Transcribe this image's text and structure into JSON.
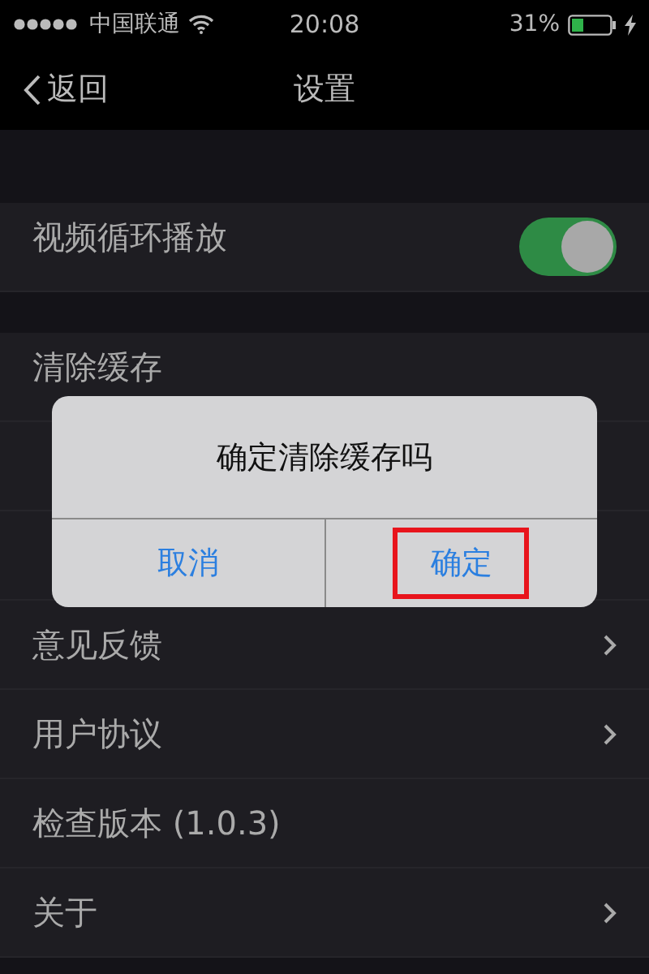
{
  "status_bar": {
    "carrier": "中国联通",
    "time": "20:08",
    "battery": "31%"
  },
  "nav": {
    "back": "返回",
    "title": "设置"
  },
  "sections": [
    {
      "rows": [
        {
          "kind": "toggle",
          "label": "视频循环播放",
          "on": true
        }
      ]
    },
    {
      "rows": [
        {
          "kind": "link",
          "label": "清除缓存",
          "chevron": false
        },
        {
          "kind": "link"
        },
        {
          "kind": "link"
        },
        {
          "kind": "link",
          "label": "意见反馈",
          "chevron": true
        },
        {
          "kind": "link",
          "label": "用户协议",
          "chevron": true
        },
        {
          "kind": "link",
          "label": "检查版本 (1.0.3)",
          "chevron": false
        },
        {
          "kind": "link",
          "label": "关于",
          "chevron": true
        }
      ]
    }
  ],
  "dialog": {
    "message": "确定清除缓存吗",
    "buttons": [
      {
        "label": "取消",
        "highlighted": false
      },
      {
        "label": "确定",
        "highlighted": true
      }
    ]
  }
}
